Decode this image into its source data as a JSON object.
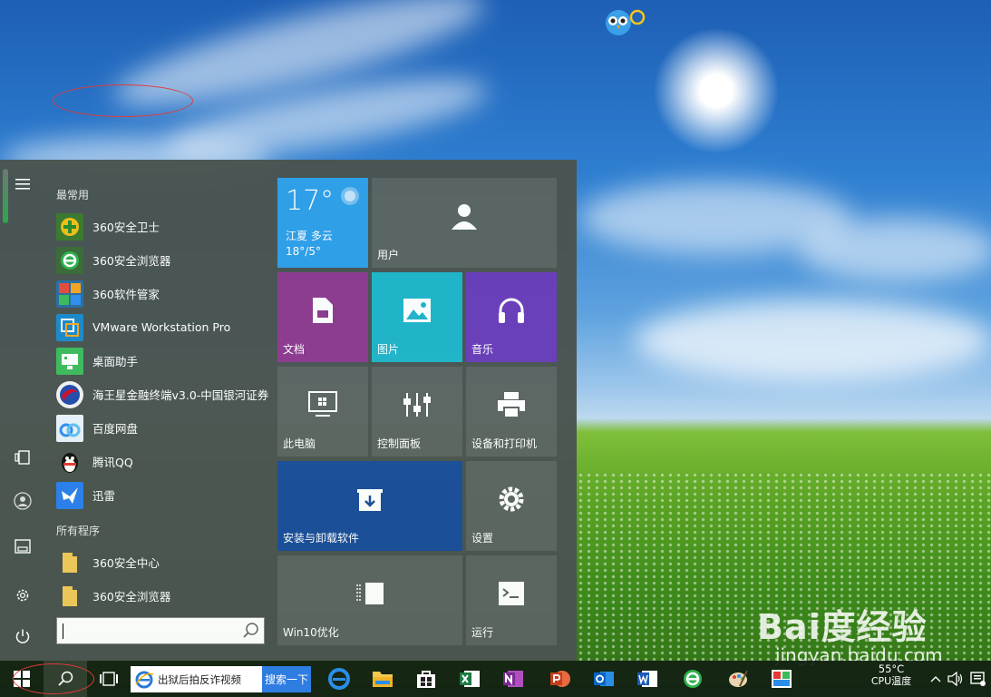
{
  "start_menu": {
    "most_used_label": "最常用",
    "most_used": [
      {
        "label": "360安全卫士",
        "icon": "shield-plus-icon",
        "color": "#f2c014"
      },
      {
        "label": "360安全浏览器",
        "icon": "browser-360-icon",
        "color": "#2fb24a"
      },
      {
        "label": "360软件管家",
        "icon": "software-manager-icon",
        "color": "#e94a3b"
      },
      {
        "label": "VMware Workstation Pro",
        "icon": "vmware-icon",
        "color": "#1b8ac9"
      },
      {
        "label": "桌面助手",
        "icon": "desktop-assistant-icon",
        "color": "#3dbb5a"
      },
      {
        "label": "海王星金融终端v3.0-中国银河证券",
        "icon": "neptune-finance-icon",
        "color": "#c8102e"
      },
      {
        "label": "百度网盘",
        "icon": "baidu-netdisk-icon",
        "color": "#2f8ff0"
      },
      {
        "label": "腾讯QQ",
        "icon": "qq-penguin-icon",
        "color": "#111111"
      },
      {
        "label": "迅雷",
        "icon": "thunder-bird-icon",
        "color": "#2a7ff0"
      }
    ],
    "all_programs_label": "所有程序",
    "all_programs": [
      {
        "label": "360安全中心",
        "icon": "folder-icon"
      },
      {
        "label": "360安全浏览器",
        "icon": "folder-icon"
      }
    ],
    "search_placeholder": ""
  },
  "tiles": {
    "weather": {
      "temp": "17°",
      "location": "江夏 多云",
      "range": "18°/5°",
      "color": "#2fa0e8"
    },
    "user": {
      "label": "用户"
    },
    "documents": {
      "label": "文档",
      "color": "#8e3a8e"
    },
    "pictures": {
      "label": "图片",
      "color": "#1fb5c9"
    },
    "music": {
      "label": "音乐",
      "color": "#6a3db8"
    },
    "this_pc": {
      "label": "此电脑"
    },
    "control_panel": {
      "label": "控制面板"
    },
    "devices_printers": {
      "label": "设备和打印机"
    },
    "install_uninstall": {
      "label": "安装与卸载软件",
      "color": "#1a4d9c"
    },
    "settings": {
      "label": "设置"
    },
    "win10_optimize": {
      "label": "Win10优化"
    },
    "run": {
      "label": "运行"
    }
  },
  "taskbar": {
    "search_suggestion": "出狱后拍反诈视频",
    "search_button": "搜索一下",
    "cpu_temp": "55°C",
    "cpu_label": "CPU温度"
  },
  "watermark": {
    "brand": "Bai度经验",
    "url": "jingyan.baidu.com"
  }
}
